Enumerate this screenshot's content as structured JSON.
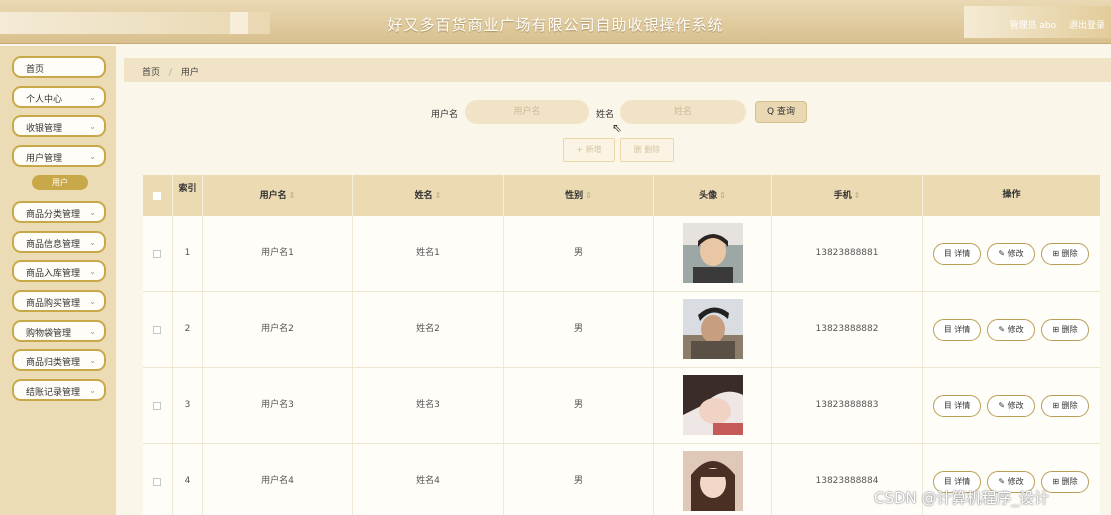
{
  "header": {
    "title": "好又多百货商业广场有限公司自助收银操作系统",
    "role": "管理员 abo",
    "logout": "退出登录"
  },
  "sidebar": {
    "items": [
      {
        "label": "首页"
      },
      {
        "label": "个人中心"
      },
      {
        "label": "收银管理"
      },
      {
        "label": "用户管理"
      },
      {
        "label": "商品分类管理"
      },
      {
        "label": "商品信息管理"
      },
      {
        "label": "商品入库管理"
      },
      {
        "label": "商品购买管理"
      },
      {
        "label": "购物袋管理"
      },
      {
        "label": "商品归类管理"
      },
      {
        "label": "结账记录管理"
      }
    ],
    "active_sub": "用户"
  },
  "breadcrumb": {
    "home": "首页",
    "sep": "/",
    "current": "用户"
  },
  "search": {
    "username_label": "用户名",
    "username_placeholder": "用户名",
    "name_label": "姓名",
    "name_placeholder": "姓名",
    "query_button": "Q 查询"
  },
  "actions": {
    "add": "+ 新增",
    "delete": "删 删除"
  },
  "table": {
    "columns": [
      "索引",
      "用户名",
      "姓名",
      "性别",
      "头像",
      "手机",
      "操作"
    ],
    "rows": [
      {
        "index": "1",
        "username": "用户名1",
        "name": "姓名1",
        "gender": "男",
        "phone": "13823888881"
      },
      {
        "index": "2",
        "username": "用户名2",
        "name": "姓名2",
        "gender": "男",
        "phone": "13823888882"
      },
      {
        "index": "3",
        "username": "用户名3",
        "name": "姓名3",
        "gender": "男",
        "phone": "13823888883"
      },
      {
        "index": "4",
        "username": "用户名4",
        "name": "姓名4",
        "gender": "男",
        "phone": "13823888884"
      }
    ],
    "row_ops": {
      "detail": "目 详情",
      "edit": "✎ 修改",
      "delete": "⊞ 删除"
    }
  },
  "watermark": "CSDN @计算机程序_设计",
  "colors": {
    "accent": "#c9a84a",
    "header": "#d8c08e",
    "table_head": "#ecdab3"
  },
  "icons": [
    "search-icon",
    "chevron-down-icon",
    "mouse-pointer-icon"
  ]
}
